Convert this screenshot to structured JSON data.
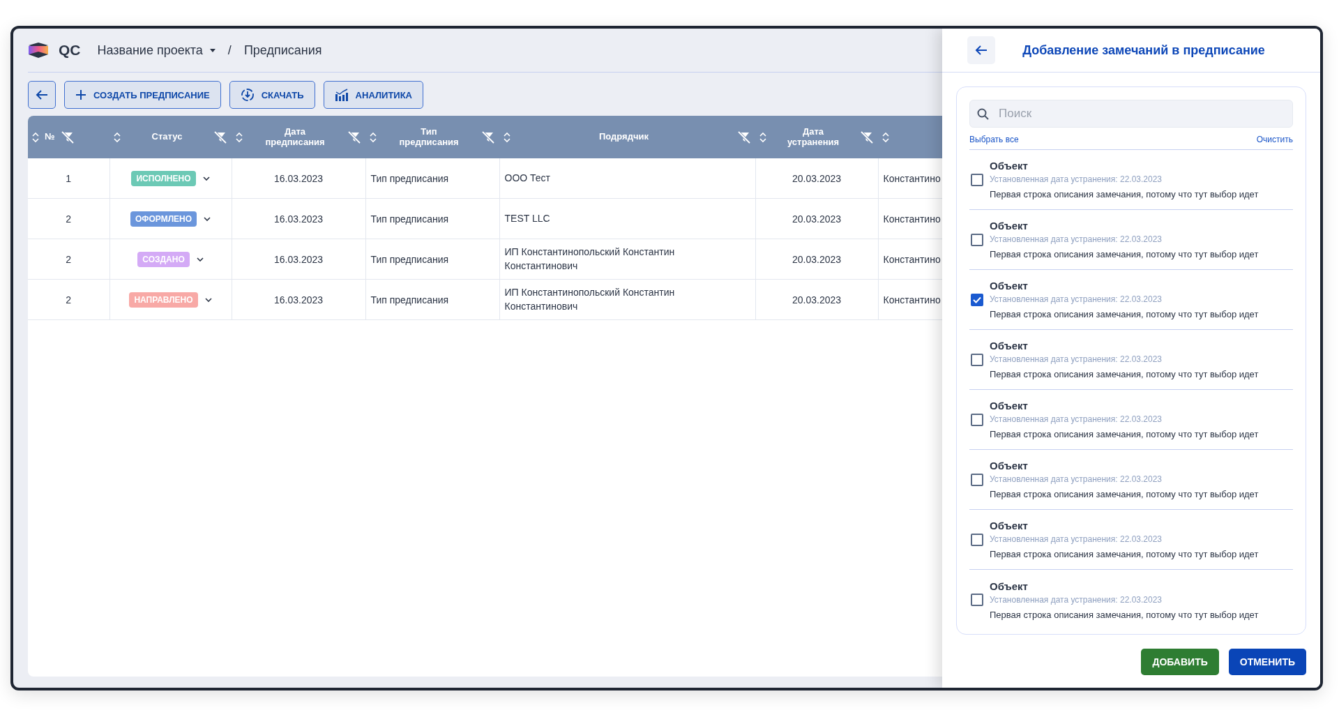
{
  "header": {
    "logo_text": "QC",
    "project": "Название проекта",
    "separator": "/",
    "page": "Предписания"
  },
  "toolbar": {
    "buttons": [
      {
        "kind": "create",
        "label": "СОЗДАТЬ ПРЕДПИСАНИЕ"
      },
      {
        "kind": "download",
        "label": "СКАЧАТЬ"
      },
      {
        "kind": "analytics",
        "label": "АНАЛИТИКА"
      }
    ]
  },
  "table": {
    "columns": [
      {
        "label": "№",
        "filter": true
      },
      {
        "label": "Статус",
        "filter": true
      },
      {
        "label": "Дата предписания",
        "filter": true
      },
      {
        "label": "Тип предписания",
        "filter": true
      },
      {
        "label": "Подрядчик",
        "filter": true
      },
      {
        "label": "Дата устранения",
        "filter": true
      },
      {
        "filter": false
      }
    ],
    "rows": [
      {
        "number": "1",
        "status": {
          "label": "ИСПОЛНЕНО",
          "color": "#6cc9b5"
        },
        "date": "16.03.2023",
        "type": "Тип предписания",
        "contractor": "ООО Тест",
        "due_date": "20.03.2023",
        "column_7": "Константино"
      },
      {
        "number": "2",
        "status": {
          "label": "ОФОРМЛЕНО",
          "color": "#6b96dc"
        },
        "date": "16.03.2023",
        "type": "Тип предписания",
        "contractor": "TEST LLC",
        "due_date": "20.03.2023",
        "column_7": "Константино"
      },
      {
        "number": "2",
        "status": {
          "label": "СОЗДАНО",
          "color": "#d4aaf6"
        },
        "date": "16.03.2023",
        "type": "Тип предписания",
        "contractor": "ИП Константинопольский Константин Константинович",
        "due_date": "20.03.2023",
        "column_7": "Константино"
      },
      {
        "number": "2",
        "status": {
          "label": "НАПРАВЛЕНО",
          "color": "#f8a9a6"
        },
        "date": "16.03.2023",
        "type": "Тип предписания",
        "contractor": "ИП Константинопольский Константин Константинович",
        "due_date": "20.03.2023",
        "column_7": "Константино"
      }
    ]
  },
  "panel": {
    "title": "Добавление замечаний в предписание",
    "search": {
      "placeholder": "Поиск"
    },
    "select_all": "Выбрать все",
    "clear": "Очистить",
    "items": [
      {
        "title": "Объект",
        "date_line": "Установленная дата устранения: 22.03.2023",
        "description": "Первая строка описания замечания, потому что тут выбор идет",
        "checked": false
      },
      {
        "title": "Объект",
        "date_line": "Установленная дата устранения: 22.03.2023",
        "description": "Первая строка описания замечания, потому что тут выбор идет",
        "checked": false
      },
      {
        "title": "Объект",
        "date_line": "Установленная дата устранения: 22.03.2023",
        "description": "Первая строка описания замечания, потому что тут выбор идет",
        "checked": true
      },
      {
        "title": "Объект",
        "date_line": "Установленная дата устранения: 22.03.2023",
        "description": "Первая строка описания замечания, потому что тут выбор идет",
        "checked": false
      },
      {
        "title": "Объект",
        "date_line": "Установленная дата устранения: 22.03.2023",
        "description": "Первая строка описания замечания, потому что тут выбор идет",
        "checked": false
      },
      {
        "title": "Объект",
        "date_line": "Установленная дата устранения: 22.03.2023",
        "description": "Первая строка описания замечания, потому что тут выбор идет",
        "checked": false
      },
      {
        "title": "Объект",
        "date_line": "Установленная дата устранения: 22.03.2023",
        "description": "Первая строка описания замечания, потому что тут выбор идет",
        "checked": false
      },
      {
        "title": "Объект",
        "date_line": "Установленная дата устранения: 22.03.2023",
        "description": "Первая строка описания замечания, потому что тут выбор идет",
        "checked": false
      }
    ],
    "buttons": {
      "add": "ДОБАВИТЬ",
      "cancel": "ОТМЕНИТЬ"
    }
  }
}
